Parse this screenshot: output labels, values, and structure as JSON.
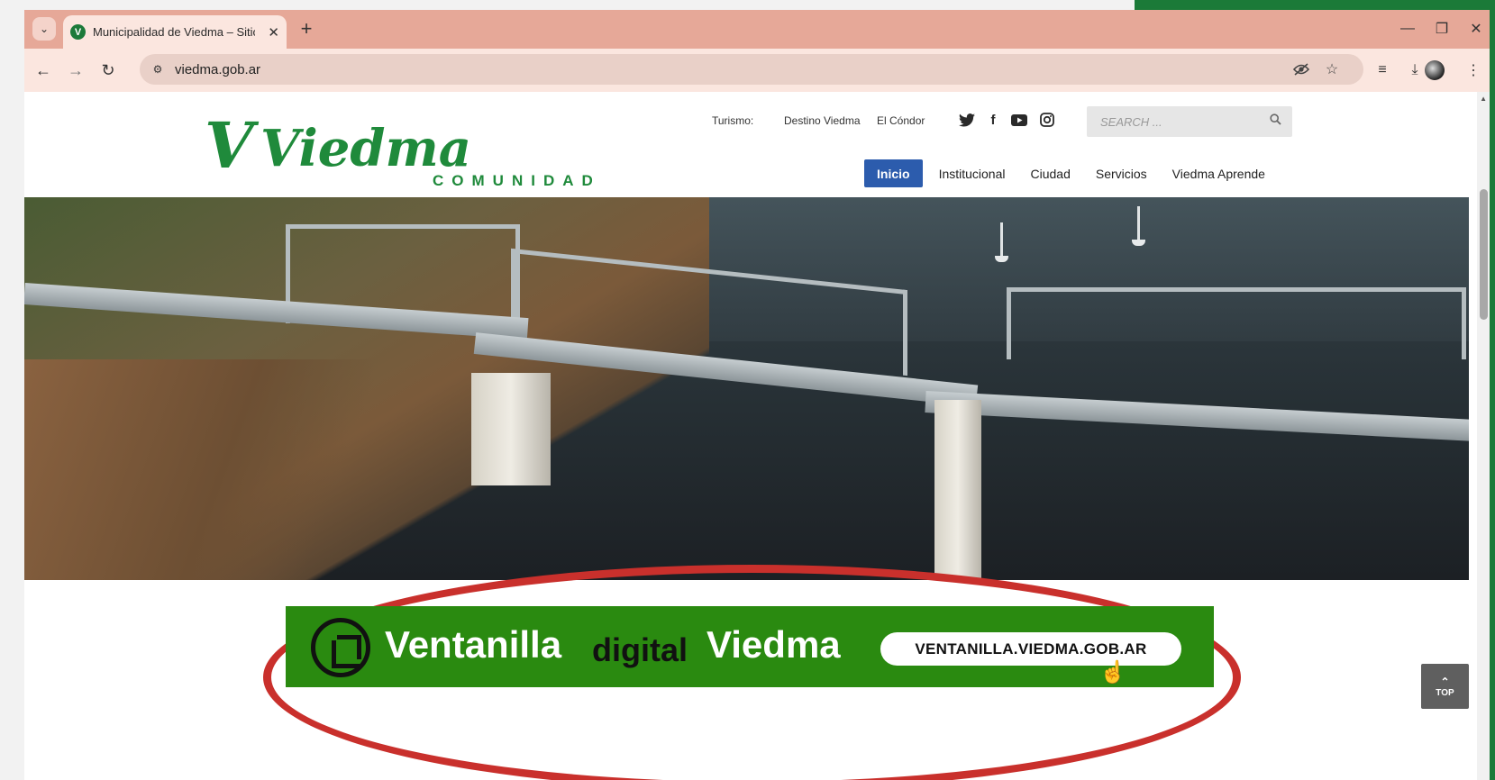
{
  "browser": {
    "tab": {
      "title": "Municipalidad de Viedma – Sitio",
      "favicon_letter": "V"
    },
    "new_tab_glyph": "+",
    "url": "viedma.gob.ar",
    "icons": {
      "tab_search": "chevron-down-icon",
      "back": "arrow-left-icon",
      "forward": "arrow-right-icon",
      "reload": "reload-icon",
      "site_info": "tune-icon",
      "eye_off": "eye-off-icon",
      "bookmark": "star-icon",
      "reading_list": "reading-list-icon",
      "download": "download-icon",
      "menu": "kebab-menu-icon",
      "minimize": "minimize-icon",
      "restore": "restore-icon",
      "close": "close-icon"
    }
  },
  "site": {
    "logo": {
      "main": "Viedma",
      "sub": "COMUNIDAD"
    },
    "topbar": {
      "turismo_label": "Turismo:",
      "links": [
        "Destino Viedma",
        "El Cóndor"
      ]
    },
    "social": [
      "twitter-icon",
      "facebook-icon",
      "youtube-icon",
      "instagram-icon"
    ],
    "search": {
      "placeholder": "SEARCH ..."
    },
    "menu": [
      "Inicio",
      "Institucional",
      "Ciudad",
      "Servicios",
      "Viedma Aprende"
    ],
    "active_menu": "Inicio",
    "banner": {
      "word1": "Ventanilla",
      "word2": "digital",
      "word3": "Viedma",
      "url_button": "VENTANILLA.VIEDMA.GOB.AR"
    },
    "top_button": {
      "label": "TOP"
    }
  },
  "colors": {
    "brand_green": "#1f8a3b",
    "banner_green": "#2a8a10",
    "menu_active": "#2c5cad",
    "highlight_oval": "#c9302c",
    "tabstrip": "#e6a898"
  }
}
